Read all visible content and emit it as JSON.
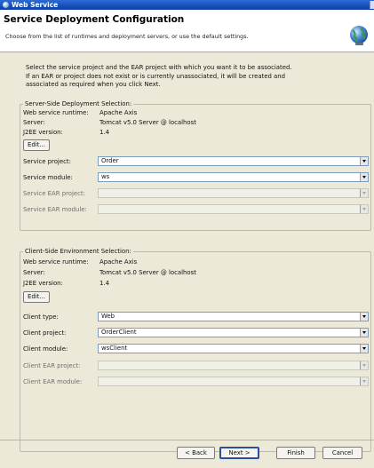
{
  "window": {
    "title": "Web Service"
  },
  "header": {
    "title": "Service Deployment Configuration",
    "description": "Choose from the list of runtimes and deployment servers, or use the default settings."
  },
  "intro": {
    "line1": "Select the service project and the EAR project with which you want it to be associated.",
    "line2": "If an EAR or project does not exist or is currently unassociated, it will be created and",
    "line3": "associated as required when you click Next."
  },
  "server": {
    "legend": "Server-Side Deployment Selection:",
    "runtime_label": "Web service runtime:",
    "runtime_value": "Apache Axis",
    "server_label": "Server:",
    "server_value": "Tomcat v5.0 Server @ localhost",
    "j2ee_label": "J2EE version:",
    "j2ee_value": "1.4",
    "edit_label": "Edit...",
    "fields": [
      {
        "label": "Service project:",
        "value": "Order",
        "enabled": true
      },
      {
        "label": "Service module:",
        "value": "ws",
        "enabled": true
      },
      {
        "label": "Service EAR project:",
        "value": "",
        "enabled": false
      },
      {
        "label": "Service EAR module:",
        "value": "",
        "enabled": false
      }
    ]
  },
  "client": {
    "legend": "Client-Side Environment Selection:",
    "runtime_label": "Web service runtime:",
    "runtime_value": "Apache Axis",
    "server_label": "Server:",
    "server_value": "Tomcat v5.0 Server @ localhost",
    "j2ee_label": "J2EE version:",
    "j2ee_value": "1.4",
    "edit_label": "Edit...",
    "fields": [
      {
        "label": "Client type:",
        "value": "Web",
        "enabled": true
      },
      {
        "label": "Client project:",
        "value": "OrderClient",
        "enabled": true
      },
      {
        "label": "Client module:",
        "value": "wsClient",
        "enabled": true
      },
      {
        "label": "Client EAR project:",
        "value": "",
        "enabled": false
      },
      {
        "label": "Client EAR module:",
        "value": "",
        "enabled": false
      }
    ]
  },
  "footer": {
    "back_label": "< Back",
    "next_label": "Next >",
    "finish_label": "Finish",
    "cancel_label": "Cancel"
  },
  "colors": {
    "titlebar": "#0b3fa8",
    "accent": "#2a4fa2",
    "panel": "#ece9d8"
  }
}
